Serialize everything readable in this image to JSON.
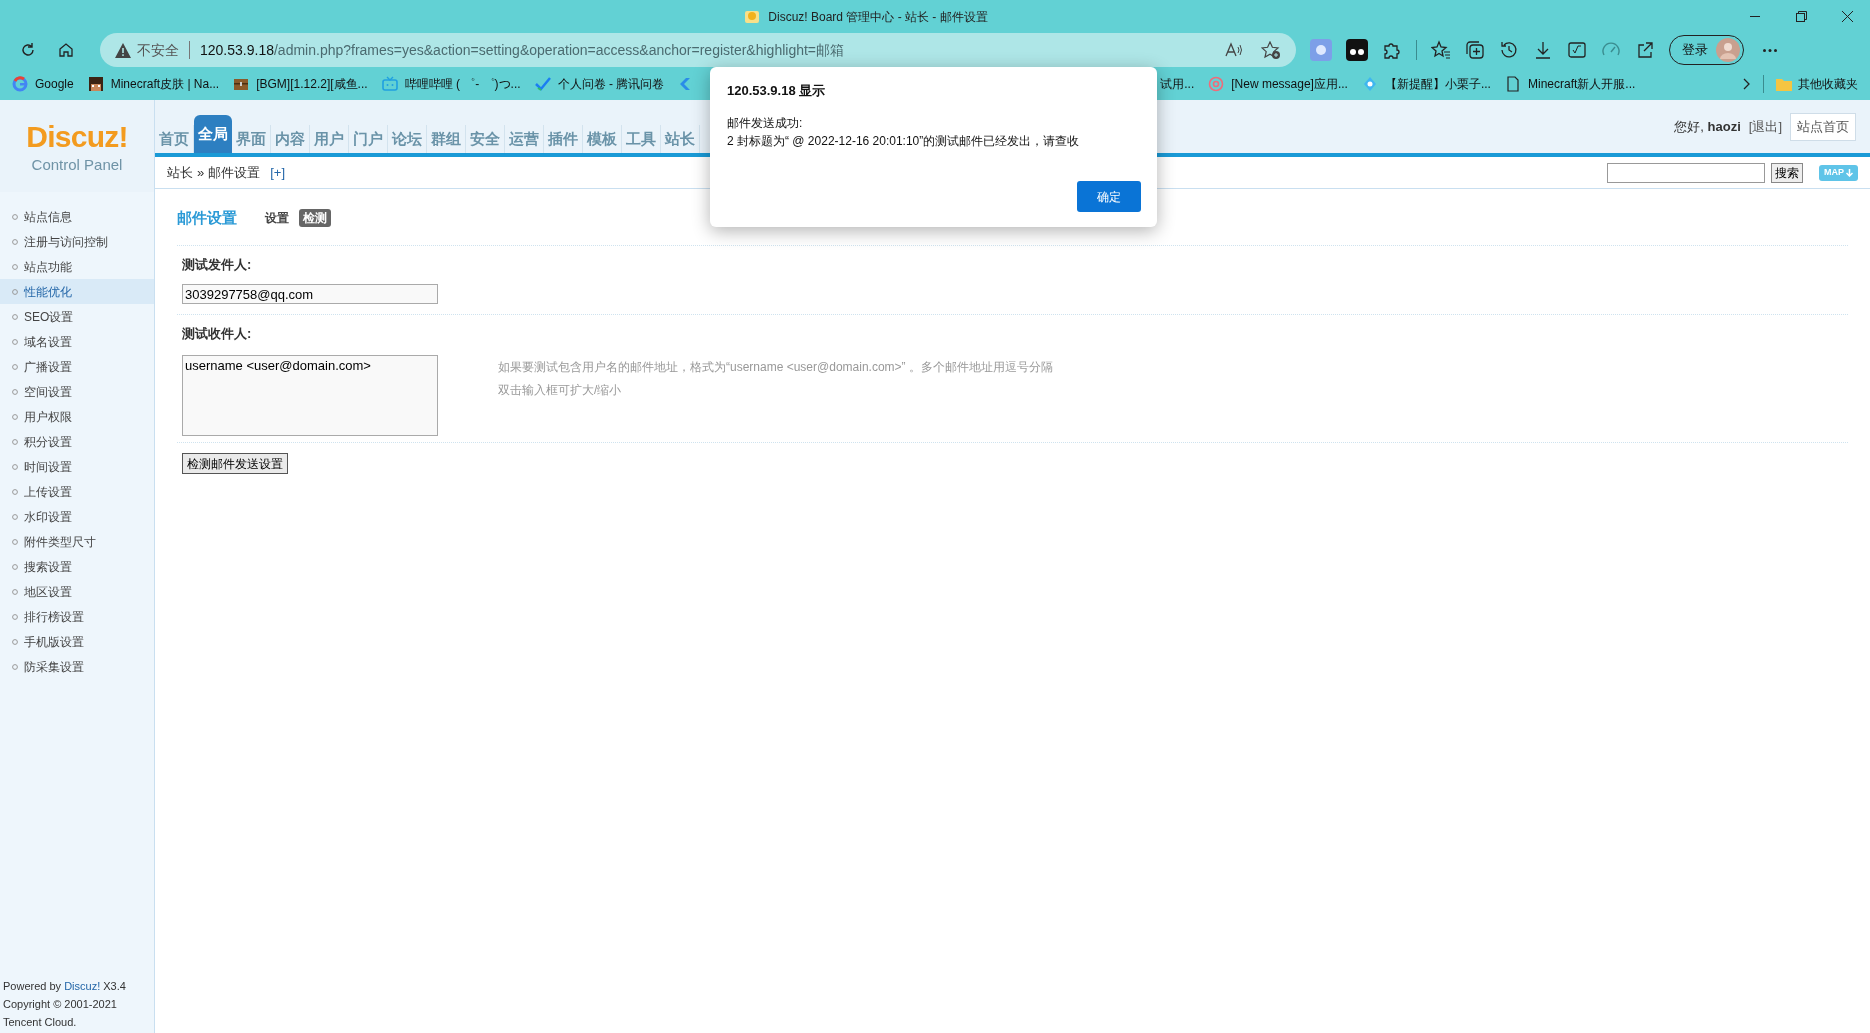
{
  "window": {
    "title": "Discuz! Board 管理中心 - 站长 - 邮件设置"
  },
  "toolbar": {
    "security_label": "不安全",
    "host": "120.53.9.18",
    "path": "/admin.php?frames=yes&action=setting&operation=access&anchor=register&highlight=邮箱",
    "sign_in": "登录"
  },
  "bookmarks": [
    {
      "label": "Google"
    },
    {
      "label": "Minecraft皮肤 | Na..."
    },
    {
      "label": "[BGM][1.12.2][咸鱼..."
    },
    {
      "label": "哔哩哔哩 ( ゜- ゜)つ..."
    },
    {
      "label": "个人问卷 - 腾讯问卷"
    },
    {
      "label": "试用..."
    },
    {
      "label": "[New message]应用..."
    },
    {
      "label": "【新提醒】小栗子..."
    },
    {
      "label": "Minecraft新人开服..."
    }
  ],
  "other_bookmarks": "其他收藏夹",
  "logo": {
    "name": "Discuz!",
    "subtitle": "Control Panel"
  },
  "nav": [
    {
      "label": "首页",
      "selected": false
    },
    {
      "label": "全局",
      "selected": true
    },
    {
      "label": "界面",
      "selected": false
    },
    {
      "label": "内容",
      "selected": false
    },
    {
      "label": "用户",
      "selected": false
    },
    {
      "label": "门户",
      "selected": false
    },
    {
      "label": "论坛",
      "selected": false
    },
    {
      "label": "群组",
      "selected": false
    },
    {
      "label": "安全",
      "selected": false
    },
    {
      "label": "运营",
      "selected": false
    },
    {
      "label": "插件",
      "selected": false
    },
    {
      "label": "模板",
      "selected": false
    },
    {
      "label": "工具",
      "selected": false
    },
    {
      "label": "站长",
      "selected": false
    }
  ],
  "user": {
    "greeting": "您好,",
    "username": "haozi",
    "logout": "[退出]",
    "home": "站点首页"
  },
  "breadcrumb": {
    "parent": "站长",
    "separator": "»",
    "current": "邮件设置",
    "add": "[+]"
  },
  "search": {
    "button": "搜索",
    "map": "MAP"
  },
  "sidebar": {
    "items": [
      {
        "label": "站点信息",
        "selected": false
      },
      {
        "label": "注册与访问控制",
        "selected": false
      },
      {
        "label": "站点功能",
        "selected": false
      },
      {
        "label": "性能优化",
        "selected": true
      },
      {
        "label": "SEO设置",
        "selected": false
      },
      {
        "label": "域名设置",
        "selected": false
      },
      {
        "label": "广播设置",
        "selected": false
      },
      {
        "label": "空间设置",
        "selected": false
      },
      {
        "label": "用户权限",
        "selected": false
      },
      {
        "label": "积分设置",
        "selected": false
      },
      {
        "label": "时间设置",
        "selected": false
      },
      {
        "label": "上传设置",
        "selected": false
      },
      {
        "label": "水印设置",
        "selected": false
      },
      {
        "label": "附件类型尺寸",
        "selected": false
      },
      {
        "label": "搜索设置",
        "selected": false
      },
      {
        "label": "地区设置",
        "selected": false
      },
      {
        "label": "排行榜设置",
        "selected": false
      },
      {
        "label": "手机版设置",
        "selected": false
      },
      {
        "label": "防采集设置",
        "selected": false
      }
    ]
  },
  "page": {
    "title": "邮件设置",
    "tabs": [
      {
        "label": "设置",
        "selected": false
      },
      {
        "label": "检测",
        "selected": true
      }
    ],
    "sender": {
      "label": "测试发件人:",
      "value": "3039297758@qq.com"
    },
    "recipient": {
      "label": "测试收件人:",
      "value": "username <user@domain.com>",
      "hints": [
        "如果要测试包含用户名的邮件地址，格式为“username <user@domain.com>” 。多个邮件地址用逗号分隔",
        "双击输入框可扩大/缩小"
      ]
    },
    "submit": "检测邮件发送设置"
  },
  "footer": {
    "powered_prefix": "Powered by ",
    "powered_link": "Discuz!",
    "powered_suffix": " X3.4",
    "copyright": "Copyright © 2001-2021",
    "company": "Tencent Cloud."
  },
  "dialog": {
    "title": "120.53.9.18 显示",
    "lines": [
      "邮件发送成功:",
      "2 封标题为“ @ 2022-12-16 20:01:10”的测试邮件已经发出，请查收"
    ],
    "ok": "确定"
  }
}
